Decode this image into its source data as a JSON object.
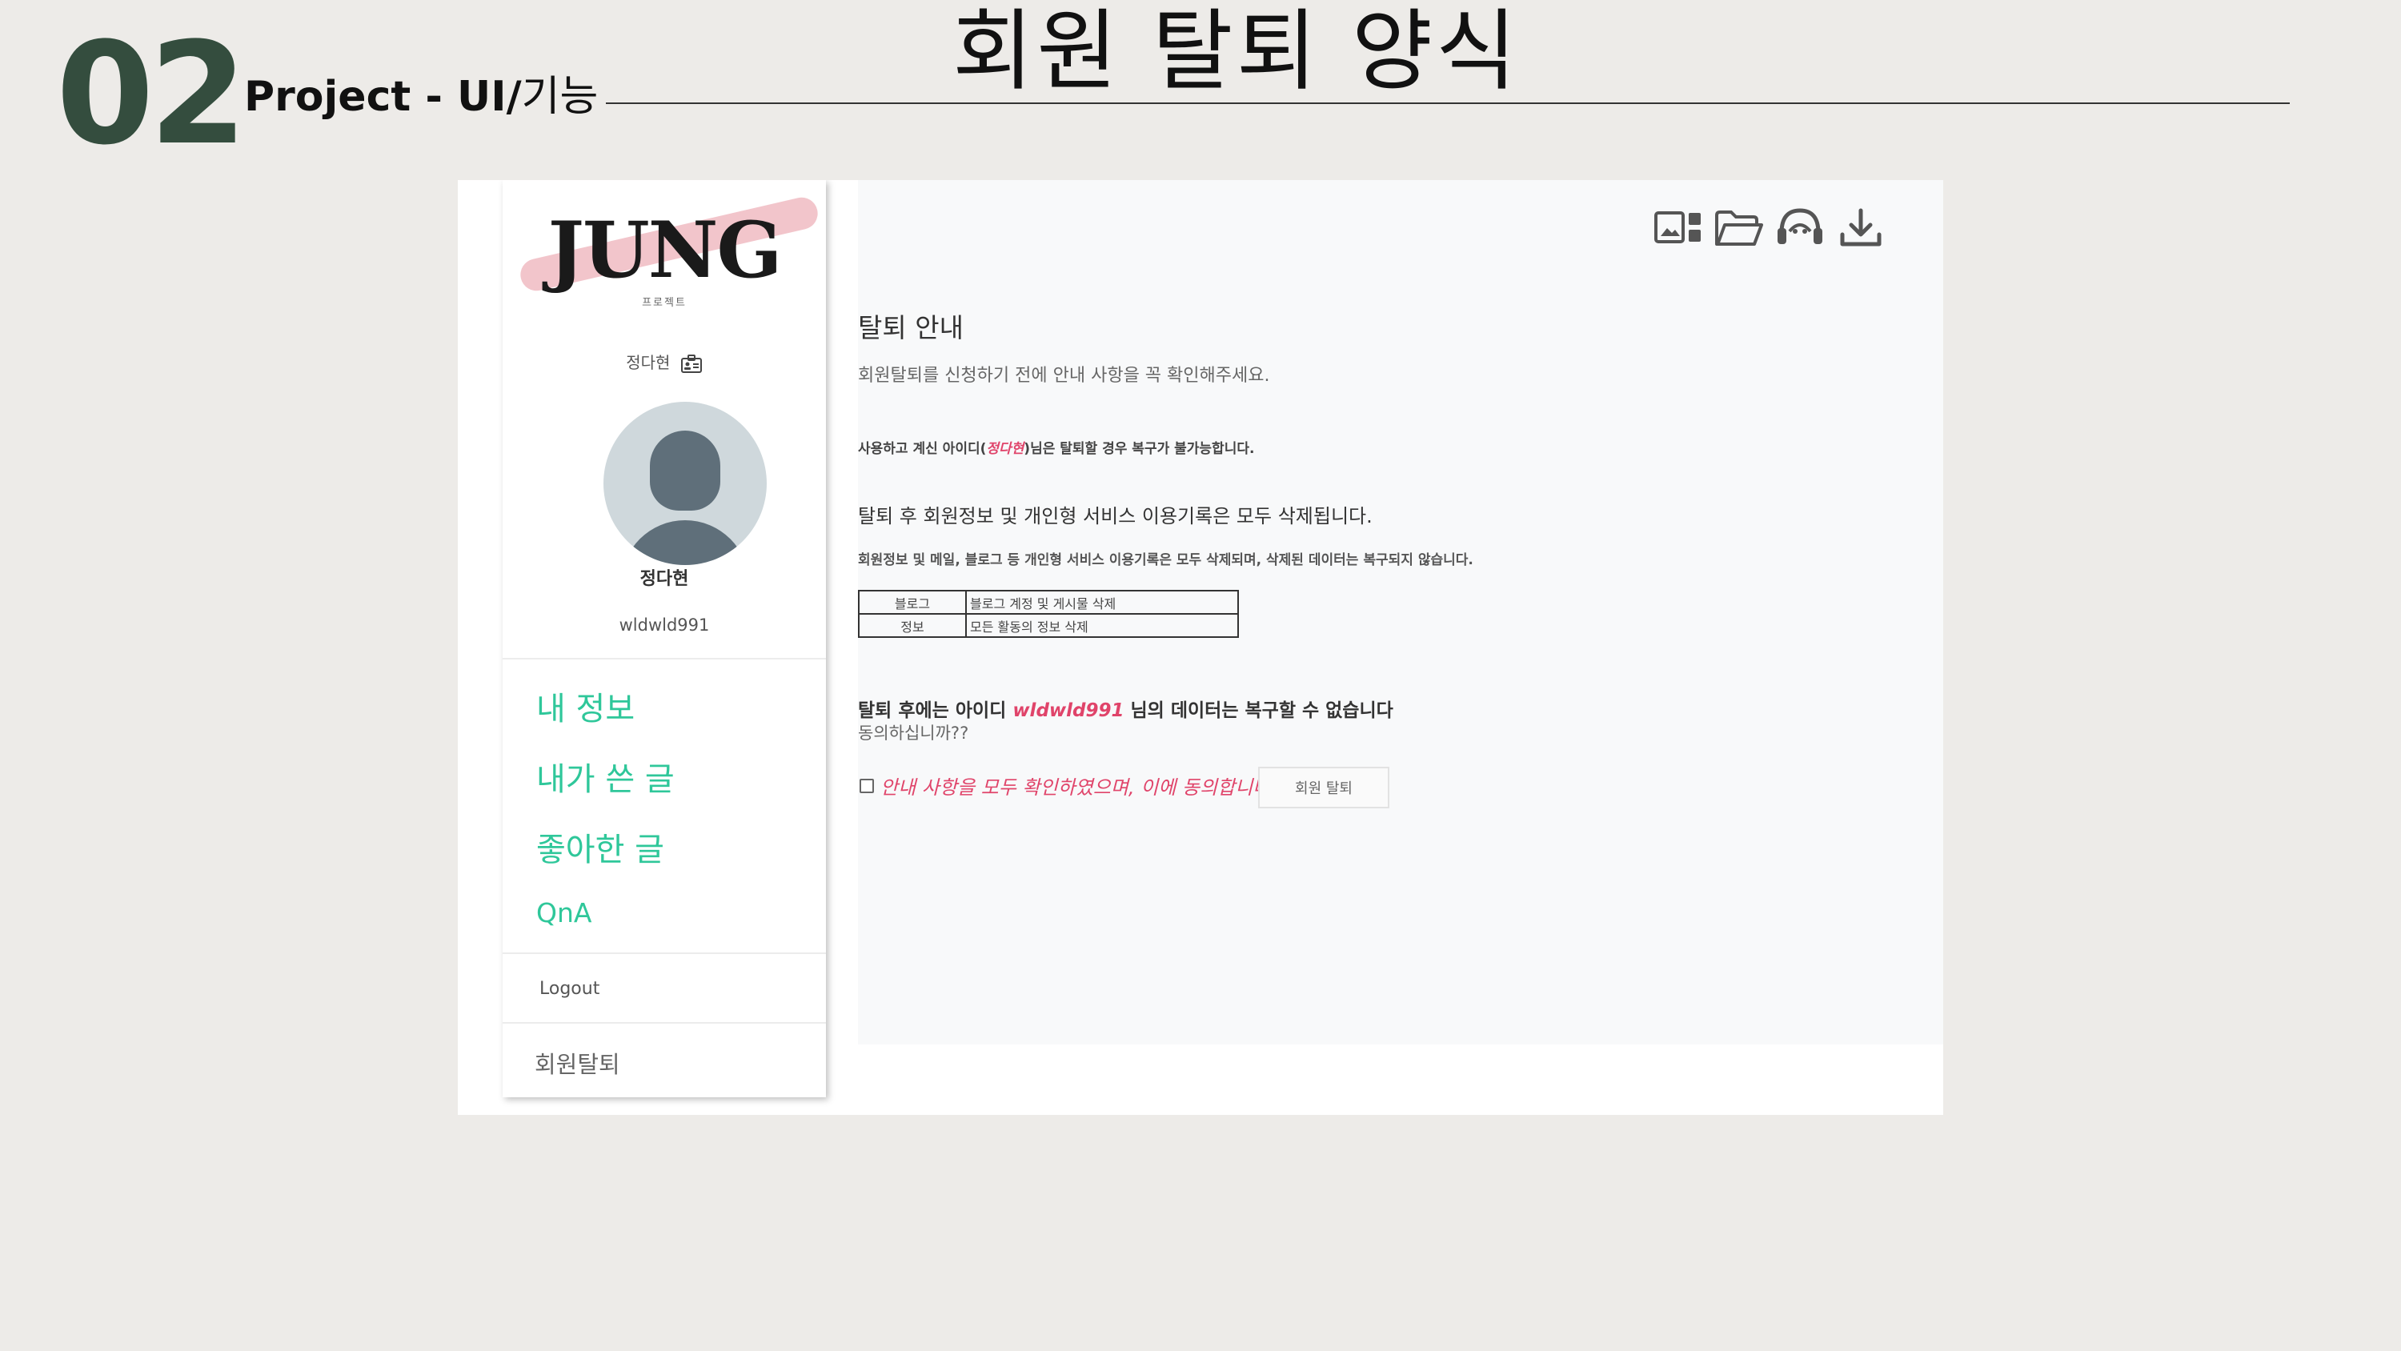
{
  "slide": {
    "number": "02",
    "section_bold": "Project - UI/",
    "section_rest": "기능",
    "title": "회원 탈퇴 양식"
  },
  "sidebar": {
    "logo": "JUNG",
    "logo_sub": "프로젝트",
    "user_top": "정다현",
    "user_name": "정다현",
    "user_id": "wldwld991",
    "menu": [
      "내 정보",
      "내가 쓴 글",
      "좋아한 글",
      "QnA"
    ],
    "logout": "Logout",
    "withdraw": "회원탈퇴"
  },
  "toolbar": {
    "icons": [
      "image-layout-icon",
      "folder-open-icon",
      "headset-icon",
      "download-icon"
    ]
  },
  "content": {
    "title": "탈퇴 안내",
    "intro": "회원탈퇴를 신청하기 전에 안내 사항을 꼭 확인해주세요.",
    "warn_pre": "사용하고 계신 아이디(",
    "warn_name": "정다현",
    "warn_post": ")님은 탈퇴할 경우 복구가 불가능합니다.",
    "sub": "탈퇴 후 회원정보 및 개인형 서비스 이용기록은 모두 삭제됩니다.",
    "detail": "회원정보 및 메일, 블로그 등 개인형 서비스 이용기록은 모두 삭제되며, 삭제된 데이터는 복구되지 않습니다.",
    "table": [
      {
        "key": "블로그",
        "value": "블로그 계정 및 게시물 삭제"
      },
      {
        "key": "정보",
        "value": "모든 활동의 정보 삭제"
      }
    ],
    "final_pre": "탈퇴 후에는 아이디 ",
    "final_id": "wldwld991",
    "final_post": " 님의 데이터는 복구할 수 없습니다",
    "confirm": "동의하십니까??",
    "agree_label": "안내 사항을 모두 확인하였으며, 이에 동의합니다.",
    "withdraw_button": "회원 탈퇴"
  },
  "colors": {
    "accent_green": "#2fc79a",
    "highlight_red": "#e0446a",
    "slide_number": "#344d3e"
  }
}
